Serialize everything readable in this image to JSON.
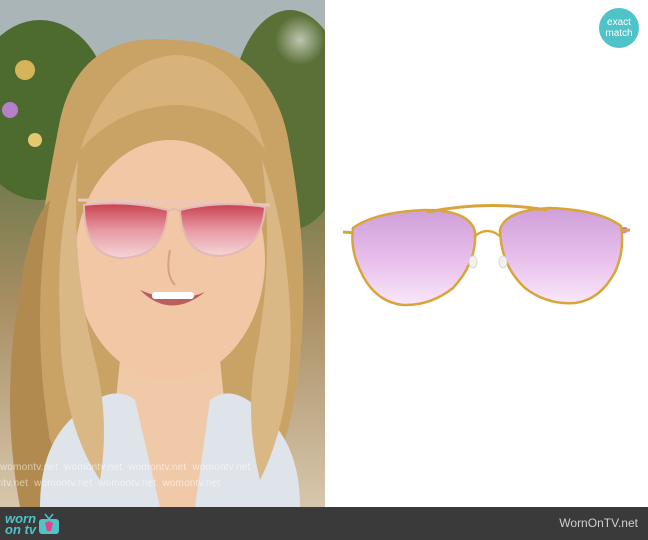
{
  "badge": {
    "line1": "exact",
    "line2": "match",
    "color": "#4fc3c7"
  },
  "watermark": {
    "text": "womontv.net"
  },
  "footer": {
    "logo_top": "worn",
    "logo_bottom": "on tv",
    "site_name": "WornOnTV.net",
    "background": "#3a3a3a",
    "accent": "#4fc3c7"
  },
  "product": {
    "item": "sunglasses",
    "frame_color": "#d9a53a",
    "lens_color": "#e2a8e6",
    "temple_color": "#d36fe0"
  }
}
